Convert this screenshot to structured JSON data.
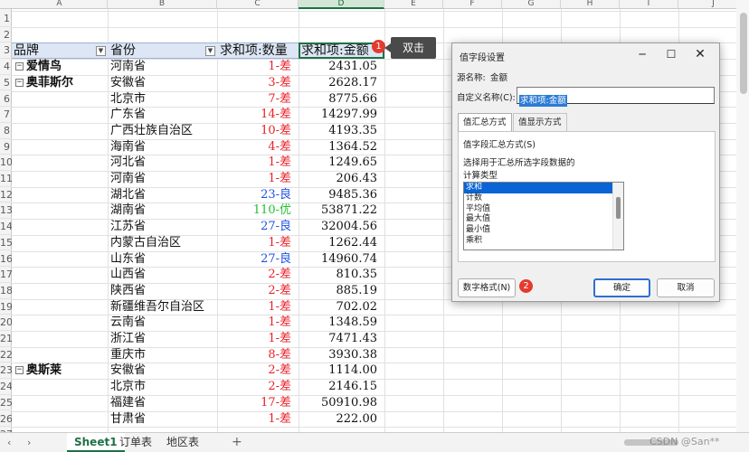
{
  "sheet": {
    "columns": [
      "A",
      "B",
      "C",
      "D",
      "E",
      "F",
      "G",
      "H",
      "I",
      "J"
    ],
    "row_numbers": [
      "1",
      "2",
      "3",
      "4",
      "5",
      "6",
      "7",
      "8",
      "9",
      "10",
      "11",
      "12",
      "13",
      "14",
      "15",
      "16",
      "17",
      "18",
      "19",
      "20",
      "21",
      "22",
      "23",
      "24",
      "25",
      "26",
      "27"
    ],
    "headers": {
      "brand": "品牌",
      "province": "省份",
      "qty": "求和项:数量",
      "amount": "求和项:金额"
    },
    "rows": [
      {
        "brand": "爱情鸟",
        "province": "河南省",
        "qty": "1-差",
        "amount": "2431.05",
        "color": "red"
      },
      {
        "brand": "奥菲斯尔",
        "province": "安徽省",
        "qty": "3-差",
        "amount": "2628.17",
        "color": "red"
      },
      {
        "brand": "",
        "province": "北京市",
        "qty": "7-差",
        "amount": "8775.66",
        "color": "red"
      },
      {
        "brand": "",
        "province": "广东省",
        "qty": "14-差",
        "amount": "14297.99",
        "color": "red"
      },
      {
        "brand": "",
        "province": "广西壮族自治区",
        "qty": "10-差",
        "amount": "4193.35",
        "color": "red"
      },
      {
        "brand": "",
        "province": "海南省",
        "qty": "4-差",
        "amount": "1364.52",
        "color": "red"
      },
      {
        "brand": "",
        "province": "河北省",
        "qty": "1-差",
        "amount": "1249.65",
        "color": "red"
      },
      {
        "brand": "",
        "province": "河南省",
        "qty": "1-差",
        "amount": "206.43",
        "color": "red"
      },
      {
        "brand": "",
        "province": "湖北省",
        "qty": "23-良",
        "amount": "9485.36",
        "color": "blue"
      },
      {
        "brand": "",
        "province": "湖南省",
        "qty": "110-优",
        "amount": "53871.22",
        "color": "green"
      },
      {
        "brand": "",
        "province": "江苏省",
        "qty": "27-良",
        "amount": "32004.56",
        "color": "blue"
      },
      {
        "brand": "",
        "province": "内蒙古自治区",
        "qty": "1-差",
        "amount": "1262.44",
        "color": "red"
      },
      {
        "brand": "",
        "province": "山东省",
        "qty": "27-良",
        "amount": "14960.74",
        "color": "blue"
      },
      {
        "brand": "",
        "province": "山西省",
        "qty": "2-差",
        "amount": "810.35",
        "color": "red"
      },
      {
        "brand": "",
        "province": "陕西省",
        "qty": "2-差",
        "amount": "885.19",
        "color": "red"
      },
      {
        "brand": "",
        "province": "新疆维吾尔自治区",
        "qty": "1-差",
        "amount": "702.02",
        "color": "red"
      },
      {
        "brand": "",
        "province": "云南省",
        "qty": "1-差",
        "amount": "1348.59",
        "color": "red"
      },
      {
        "brand": "",
        "province": "浙江省",
        "qty": "1-差",
        "amount": "7471.43",
        "color": "red"
      },
      {
        "brand": "",
        "province": "重庆市",
        "qty": "8-差",
        "amount": "3930.38",
        "color": "red"
      },
      {
        "brand": "奥斯莱",
        "province": "安徽省",
        "qty": "2-差",
        "amount": "1114.00",
        "color": "red"
      },
      {
        "brand": "",
        "province": "北京市",
        "qty": "2-差",
        "amount": "2146.15",
        "color": "red"
      },
      {
        "brand": "",
        "province": "福建省",
        "qty": "17-差",
        "amount": "50910.98",
        "color": "red"
      },
      {
        "brand": "",
        "province": "甘肃省",
        "qty": "1-差",
        "amount": "222.00",
        "color": "red"
      }
    ],
    "tooltip": "双击",
    "badge1": "1",
    "badge2": "2"
  },
  "tabs": {
    "nav_prev": "‹",
    "nav_next": "›",
    "items": [
      "Sheet1",
      "订单表",
      "地区表"
    ],
    "add": "+",
    "watermark": "CSDN @San**"
  },
  "dialog": {
    "title": "值字段设置",
    "source_label": "源名称:",
    "source_value": "金额",
    "custom_name_label": "自定义名称(C):",
    "custom_name_value": "求和项:金额",
    "tab_summarize": "值汇总方式",
    "tab_show_as": "值显示方式",
    "section_title": "值字段汇总方式(S)",
    "section_desc": "选择用于汇总所选字段数据的",
    "calc_type_label": "计算类型",
    "calc_options": [
      "求和",
      "计数",
      "平均值",
      "最大值",
      "最小值",
      "乘积"
    ],
    "number_format_button": "数字格式(N)",
    "ok_button": "确定",
    "cancel_button": "取消"
  },
  "colors": {
    "accent": "#1e7145",
    "header_fill": "#dce6f4",
    "bad": "#e8222a",
    "good": "#1f4fe3",
    "excellent": "#22c22e",
    "selection": "#0a64d6"
  }
}
